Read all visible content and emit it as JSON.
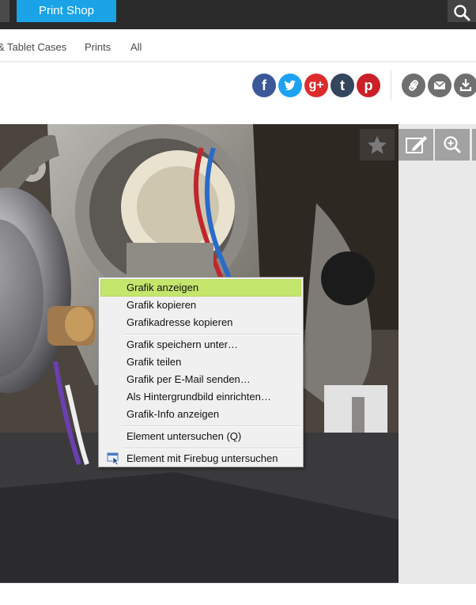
{
  "header": {
    "print_shop_label": "Print Shop",
    "search_icon": "search-icon"
  },
  "nav": {
    "items": [
      "& Tablet Cases",
      "Prints",
      "All"
    ]
  },
  "share": {
    "facebook": "f",
    "google_plus": "g+",
    "tumblr": "t",
    "pinterest": "p",
    "colors": {
      "facebook": "#3b5998",
      "twitter": "#1da1f2",
      "google_plus": "#dd2c2c",
      "tumblr": "#34465d",
      "pinterest": "#cb2027",
      "tools": "#6f6f6f"
    }
  },
  "context_menu": {
    "highlight_color": "#c5e66d",
    "items": [
      "Grafik anzeigen",
      "Grafik kopieren",
      "Grafikadresse kopieren",
      "Grafik speichern unter…",
      "Grafik teilen",
      "Grafik per E-Mail senden…",
      "Als Hintergrundbild einrichten…",
      "Grafik-Info anzeigen",
      "Element untersuchen (Q)",
      "Element mit Firebug untersuchen"
    ]
  }
}
